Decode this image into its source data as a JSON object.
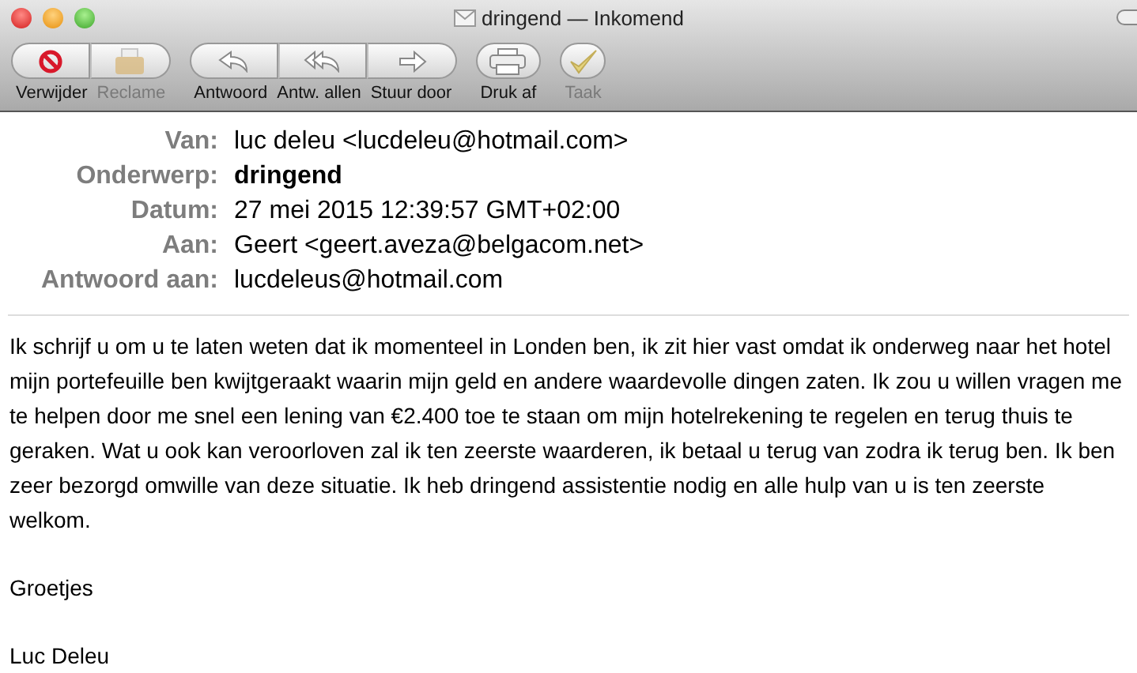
{
  "window": {
    "title": "dringend — Inkomend"
  },
  "toolbar": [
    [
      {
        "label": "Verwijder",
        "disabled": false
      },
      {
        "label": "Reclame",
        "disabled": true
      }
    ],
    [
      {
        "label": "Antwoord",
        "disabled": false
      },
      {
        "label": "Antw. allen",
        "disabled": false
      },
      {
        "label": "Stuur door",
        "disabled": false
      }
    ],
    [
      {
        "label": "Druk af",
        "disabled": false
      }
    ],
    [
      {
        "label": "Taak",
        "disabled": true
      }
    ]
  ],
  "headers": [
    {
      "label": "Van:",
      "value": "luc deleu <lucdeleu@hotmail.com>",
      "bold": false
    },
    {
      "label": "Onderwerp:",
      "value": "dringend",
      "bold": true
    },
    {
      "label": "Datum:",
      "value": "27 mei 2015 12:39:57 GMT+02:00",
      "bold": false
    },
    {
      "label": "Aan:",
      "value": "Geert <geert.aveza@belgacom.net>",
      "bold": false
    },
    {
      "label": "Antwoord aan:",
      "value": "lucdeleus@hotmail.com",
      "bold": false
    }
  ],
  "body": [
    "Ik schrijf u om u te laten weten dat ik momenteel in Londen ben, ik zit hier vast omdat ik onderweg naar het hotel mijn portefeuille ben kwijtgeraakt waarin mijn geld en andere waardevolle dingen zaten. Ik zou u willen vragen me te helpen door me snel een lening van €2.400 toe te staan om mijn hotelrekening te regelen en terug thuis te geraken. Wat u ook kan veroorloven zal ik ten zeerste waarderen, ik betaal u terug van zodra ik terug ben. Ik ben zeer bezorgd omwille van deze situatie. Ik heb dringend assistentie nodig en alle hulp van u is ten zeerste welkom.",
    "Groetjes",
    "Luc Deleu"
  ]
}
